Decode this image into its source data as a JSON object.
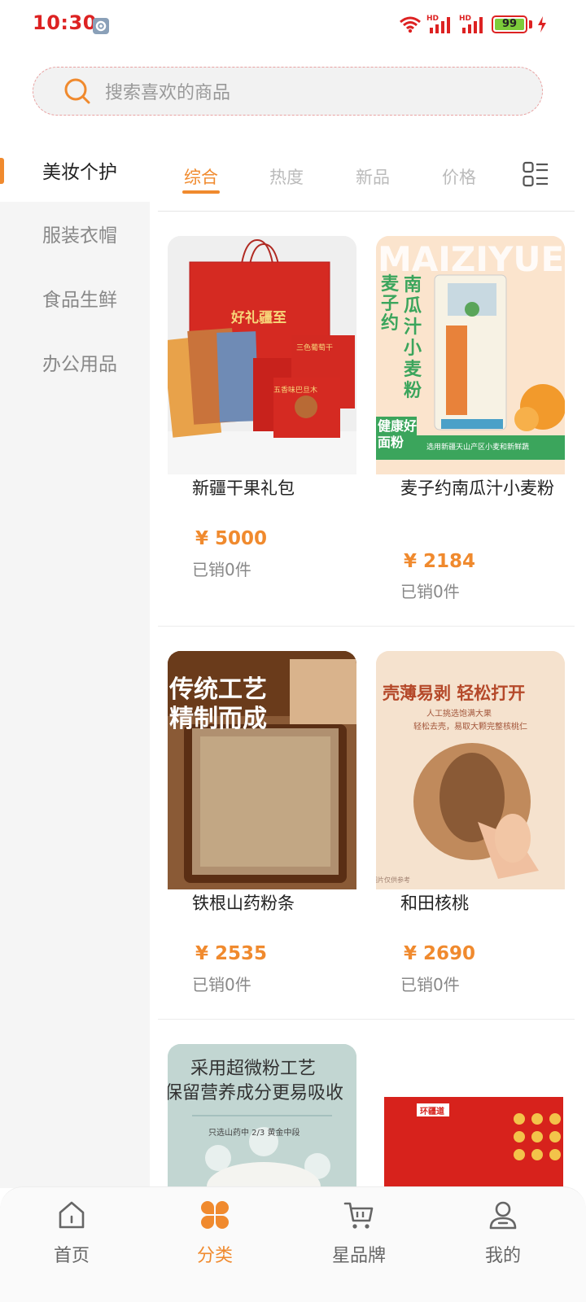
{
  "status_bar": {
    "time": "10:30",
    "battery": "99",
    "battery_level": 0.99,
    "network_badge": "HD"
  },
  "search": {
    "placeholder": "搜索喜欢的商品"
  },
  "sidebar": {
    "items": [
      {
        "label": "美妆个护",
        "active": true
      },
      {
        "label": "服装衣帽",
        "active": false
      },
      {
        "label": "食品生鲜",
        "active": false
      },
      {
        "label": "办公用品",
        "active": false
      }
    ]
  },
  "sort_tabs": [
    {
      "label": "综合",
      "active": true
    },
    {
      "label": "热度",
      "active": false
    },
    {
      "label": "新品",
      "active": false
    },
    {
      "label": "价格",
      "active": false
    }
  ],
  "products": [
    {
      "name": "新疆干果礼包",
      "price": "¥ 5000",
      "sold": "已销0件",
      "image_text": [
        "好礼疆至",
        "五香味巴旦木",
        "三色葡萄干"
      ]
    },
    {
      "name": "麦子约南瓜汁小麦粉",
      "price": "¥ 2184",
      "sold": "已销0件",
      "image_text": [
        "MAIZIYUE",
        "麦子约",
        "南瓜汁小麦粉",
        "健康好面粉",
        "选用新疆天山产区小麦和新鲜蔬"
      ]
    },
    {
      "name": "铁根山药粉条",
      "price": "¥ 2535",
      "sold": "已销0件",
      "image_text": [
        "传统工艺",
        "精制而成"
      ]
    },
    {
      "name": "和田核桃",
      "price": "¥ 2690",
      "sold": "已销0件",
      "image_text": [
        "壳薄易剥 轻松打开",
        "人工挑选饱满大果",
        "轻松去壳，易取大颗完整核桃仁",
        "图片仅供参考"
      ]
    },
    {
      "name": "",
      "price": "",
      "sold": "",
      "image_text": [
        "采用超微粉工艺",
        "保留营养成分更易吸收",
        "只选山药中 2/3 黄金中段"
      ]
    },
    {
      "name": "",
      "price": "",
      "sold": "",
      "image_text": [
        "环疆道"
      ]
    }
  ],
  "bottom_nav": [
    {
      "label": "首页",
      "icon": "home-icon",
      "active": false
    },
    {
      "label": "分类",
      "icon": "category-icon",
      "active": true
    },
    {
      "label": "星品牌",
      "icon": "cart-icon",
      "active": false
    },
    {
      "label": "我的",
      "icon": "user-icon",
      "active": false
    }
  ],
  "colors": {
    "accent": "#f08a2e",
    "sidebar_bg": "#f5f5f5",
    "status_red": "#dd2222"
  }
}
